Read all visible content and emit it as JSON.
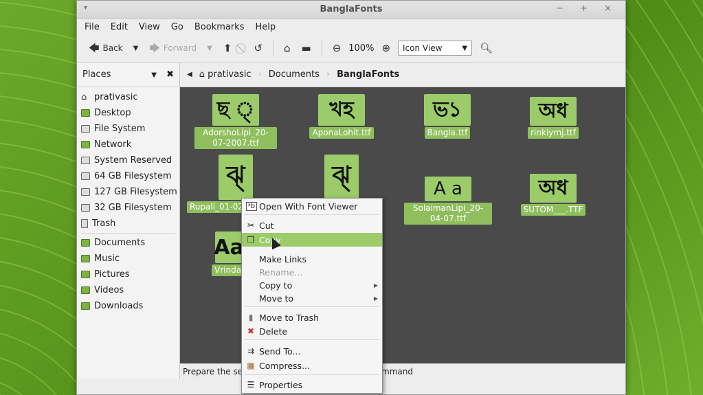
{
  "window": {
    "title": "BanglaFonts",
    "menu_glyph": "▾",
    "controls": "− + ×"
  },
  "menubar": [
    "File",
    "Edit",
    "View",
    "Go",
    "Bookmarks",
    "Help"
  ],
  "toolbar": {
    "back": "Back",
    "forward": "Forward",
    "zoom": "100%",
    "view_mode": "Icon View"
  },
  "sidebar": {
    "title": "Places",
    "devices": [
      {
        "label": "prativasic",
        "icon": "home-icon"
      },
      {
        "label": "Desktop",
        "icon": "desktop-icon"
      },
      {
        "label": "File System",
        "icon": "drive-icon"
      },
      {
        "label": "Network",
        "icon": "network-icon"
      },
      {
        "label": "System Reserved",
        "icon": "drive-icon"
      },
      {
        "label": "64 GB Filesystem",
        "icon": "drive-icon"
      },
      {
        "label": "127 GB Filesystem",
        "icon": "drive-icon"
      },
      {
        "label": "32 GB Filesystem",
        "icon": "drive-icon"
      },
      {
        "label": "Trash",
        "icon": "trash-icon"
      }
    ],
    "bookmarks": [
      {
        "label": "Documents",
        "icon": "folder-icon"
      },
      {
        "label": "Music",
        "icon": "folder-icon"
      },
      {
        "label": "Pictures",
        "icon": "folder-icon"
      },
      {
        "label": "Videos",
        "icon": "folder-icon"
      },
      {
        "label": "Downloads",
        "icon": "folder-icon"
      }
    ]
  },
  "pathbar": [
    "prativasic",
    "Documents",
    "BanglaFonts"
  ],
  "files": [
    {
      "label": "AdorshoLipi_20-07-2007.ttf",
      "preview": "ছ ্"
    },
    {
      "label": "AponaLohit.ttf",
      "preview": "খহ"
    },
    {
      "label": "Bangla.ttf",
      "preview": "ভ১"
    },
    {
      "label": "rinkiymj.ttf",
      "preview": "অধ"
    },
    {
      "label": "Rupali_01-02",
      "preview": "ঝ্"
    },
    {
      "label": "",
      "preview": "ঝ্"
    },
    {
      "label": "SolaimanLipi_20-04-07.ttf",
      "preview": "A a"
    },
    {
      "label": "SUTOM___.TTF",
      "preview": "অধ"
    },
    {
      "label": "Vrinda",
      "preview": "Aa"
    }
  ],
  "statusbar": {
    "left": "Prepare the sele",
    "right": "mmand"
  },
  "context_menu": [
    {
      "label": "Open With Font Viewer",
      "icon": "font-viewer-icon",
      "glyph": "ᵃb"
    },
    {
      "label": "Cut",
      "icon": "scissors-icon",
      "glyph": "✂"
    },
    {
      "label": "Copy",
      "icon": "copy-icon",
      "glyph": "❐"
    },
    {
      "label": "Make Links",
      "icon": "",
      "glyph": ""
    },
    {
      "label": "Rename...",
      "icon": "",
      "glyph": ""
    },
    {
      "label": "Copy to",
      "icon": "",
      "glyph": ""
    },
    {
      "label": "Move to",
      "icon": "",
      "glyph": ""
    },
    {
      "label": "Move to Trash",
      "icon": "trash-icon",
      "glyph": "🗑"
    },
    {
      "label": "Delete",
      "icon": "delete-icon",
      "glyph": "✖"
    },
    {
      "label": "Send To...",
      "icon": "send-to-icon",
      "glyph": "⇉"
    },
    {
      "label": "Compress...",
      "icon": "archive-icon",
      "glyph": "▦"
    },
    {
      "label": "Properties",
      "icon": "properties-icon",
      "glyph": "☰"
    }
  ],
  "colors": {
    "selection": "#9ccc6a",
    "content_bg": "#4a4a4a",
    "delete_red": "#d32f2f"
  }
}
